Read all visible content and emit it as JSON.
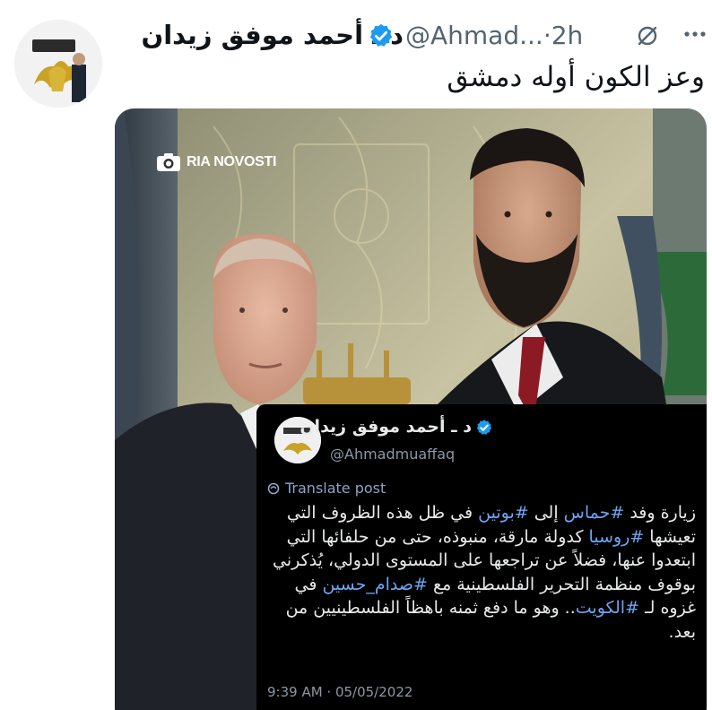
{
  "tweet": {
    "display_name": "د ـ أحمد موفق زيدان",
    "handle": "@Ahmad...",
    "separator": "·",
    "time": "2h",
    "text": "وعز الكون أوله دمشق",
    "icons": {
      "avatar": "avatar",
      "verified": "verified-badge-icon",
      "grok": "grok-icon",
      "more": "more-options-icon"
    }
  },
  "media": {
    "watermark": "RIA NOVOSTI",
    "embedded_post": {
      "display_name": "د ـ أحمد موفق زيدان",
      "handle": "@Ahmadmuaffaq",
      "translate_label": "Translate post",
      "lines": [
        [
          "زيارة وفد ",
          "#حماس",
          " إلى ",
          "#بوتين",
          " في ظل هذه الظروف التي"
        ],
        [
          "تعيشها ",
          "#روسيا",
          " كدولة مارقة، منبوذه، حتى من حلفائها التي"
        ],
        [
          "ابتعدوا عنها، فضلاً عن تراجعها على المستوى الدولي، يُذكرني"
        ],
        [
          "بوقوف منظمة التحرير الفلسطينية مع ",
          "#صدام_حسين",
          " في"
        ],
        [
          "غزوه لـ ",
          "#الكويت",
          ".. وهو ما دفع ثمنه باهظاً الفلسطينيين من"
        ],
        [
          "بعد."
        ]
      ],
      "timestamp": "9:39 AM · 05/05/2022"
    }
  },
  "colors": {
    "verified_blue": "#1d9bf0",
    "hashtag_blue": "#6ea4f2",
    "secondary_text": "#536471"
  }
}
